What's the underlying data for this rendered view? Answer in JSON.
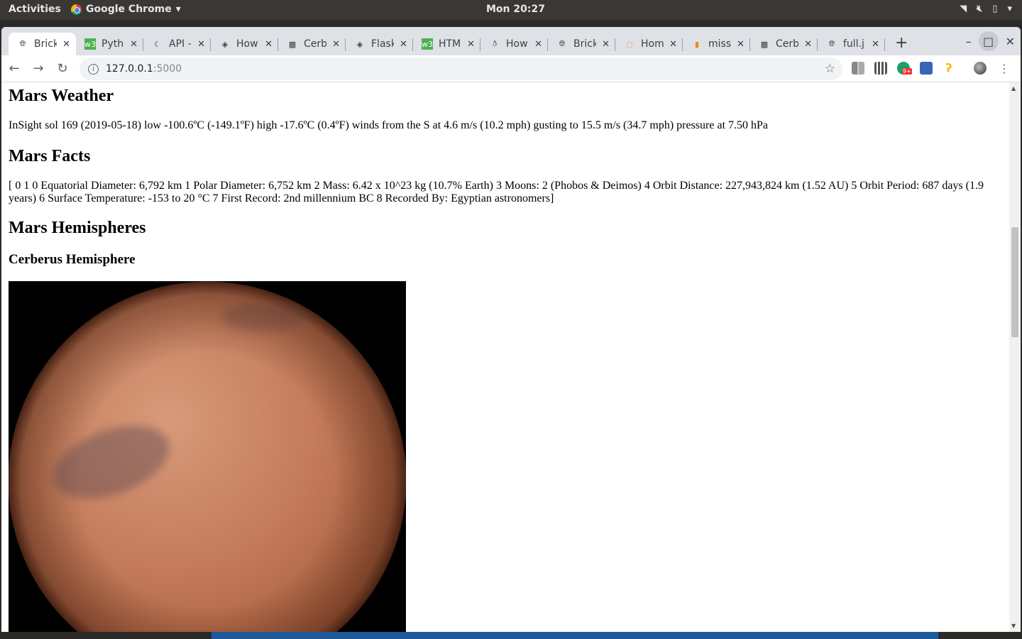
{
  "system": {
    "activities": "Activities",
    "app_name": "Google Chrome",
    "clock": "Mon 20:27"
  },
  "tabs": [
    {
      "title": "Brick",
      "icon": "globe-icon",
      "active": true
    },
    {
      "title": "Python",
      "icon": "w3schools-icon"
    },
    {
      "title": "API -",
      "icon": "moon-icon"
    },
    {
      "title": "How",
      "icon": "diamond-icon"
    },
    {
      "title": "Cerb",
      "icon": "cerberus-icon"
    },
    {
      "title": "Flask",
      "icon": "diamond-icon"
    },
    {
      "title": "HTML",
      "icon": "w3schools-icon"
    },
    {
      "title": "How",
      "icon": "linux-penguin-icon"
    },
    {
      "title": "Brick",
      "icon": "globe-icon"
    },
    {
      "title": "Home",
      "icon": "jupyter-icon"
    },
    {
      "title": "miss",
      "icon": "book-icon"
    },
    {
      "title": "Cerb",
      "icon": "cerberus-icon"
    },
    {
      "title": "full.j",
      "icon": "globe-icon"
    }
  ],
  "address": {
    "host": "127.0.0.1",
    "port": ":5000"
  },
  "extensions": {
    "badge": "9+"
  },
  "page": {
    "weather_heading": "Mars Weather",
    "weather_text": "InSight sol 169 (2019-05-18) low -100.6ºC (-149.1ºF) high -17.6ºC (0.4ºF) winds from the S at 4.6 m/s (10.2 mph) gusting to 15.5 m/s (34.7 mph) pressure at 7.50 hPa",
    "facts_heading": "Mars Facts",
    "facts_text": "[ 0 1 0 Equatorial Diameter: 6,792 km 1 Polar Diameter: 6,752 km 2 Mass: 6.42 x 10^23 kg (10.7% Earth) 3 Moons: 2 (Phobos & Deimos) 4 Orbit Distance: 227,943,824 km (1.52 AU) 5 Orbit Period: 687 days (1.9 years) 6 Surface Temperature: -153 to 20 °C 7 First Record: 2nd millennium BC 8 Recorded By: Egyptian astronomers]",
    "hemispheres_heading": "Mars Hemispheres",
    "hemisphere_title": "Cerberus Hemisphere"
  }
}
